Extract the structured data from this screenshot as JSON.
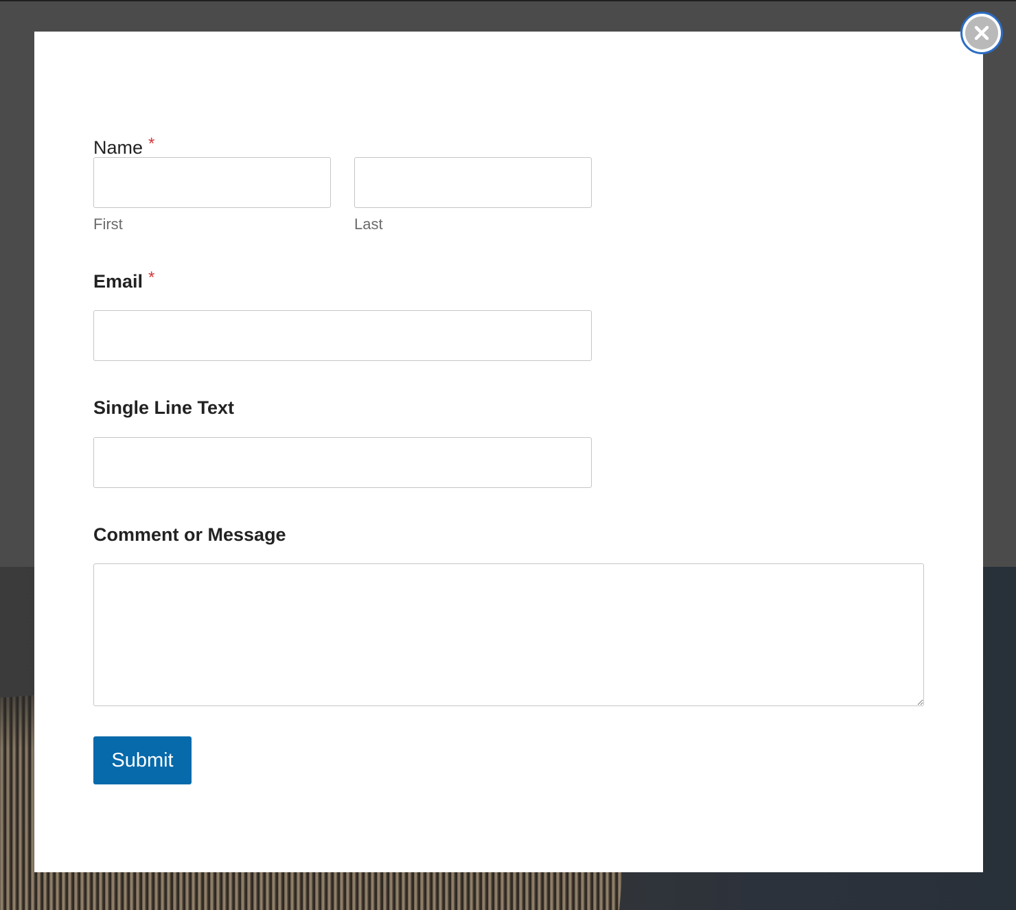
{
  "close_button": {
    "icon": "close-icon"
  },
  "form": {
    "name": {
      "label": "Name",
      "required_mark": "*",
      "first_sublabel": "First",
      "last_sublabel": "Last",
      "first_value": "",
      "last_value": ""
    },
    "email": {
      "label": "Email",
      "required_mark": "*",
      "value": ""
    },
    "single_line": {
      "label": "Single Line Text",
      "value": ""
    },
    "comment": {
      "label": "Comment or Message",
      "value": ""
    },
    "submit_label": "Submit"
  },
  "colors": {
    "accent": "#066aab",
    "required": "#d63638",
    "close_ring": "#2b6cc4"
  }
}
